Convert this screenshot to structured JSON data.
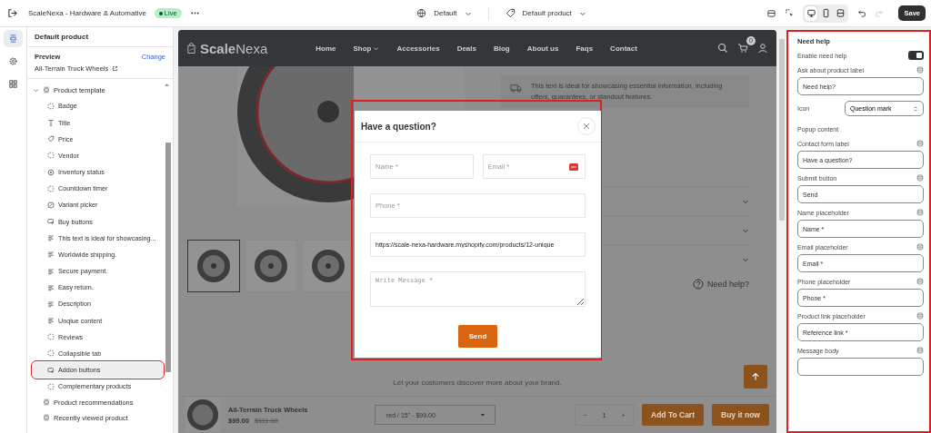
{
  "topbar": {
    "store_name": "ScaleNexa - Hardware & Automative",
    "status_badge": "Live",
    "theme_select": "Default",
    "template_select": "Default product",
    "devices": [
      {
        "kind": "desktop",
        "selected": true
      },
      {
        "kind": "mobile",
        "selected": false
      },
      {
        "kind": "split",
        "selected": false
      }
    ],
    "redo": {
      "disabled": true
    },
    "save_button": "Save"
  },
  "rail": [
    {
      "kind": "sections",
      "selected": true
    },
    {
      "kind": "settings",
      "selected": false
    },
    {
      "kind": "apps",
      "selected": false
    }
  ],
  "sidebar": {
    "title": "Default product",
    "preview_label": "Preview",
    "change_link": "Change",
    "preview_product": "All-Terrain Truck Wheels",
    "tree": [
      {
        "label": "Product template",
        "expanded": true,
        "children": [
          {
            "label": "Badge",
            "kind": "block",
            "selected": false,
            "highlighted": false
          },
          {
            "label": "Title",
            "kind": "title",
            "selected": false,
            "highlighted": false
          },
          {
            "label": "Price",
            "kind": "price",
            "selected": false,
            "highlighted": false
          },
          {
            "label": "Vendor",
            "kind": "block",
            "selected": false,
            "highlighted": false
          },
          {
            "label": "Inventory status",
            "kind": "inventory",
            "selected": false,
            "highlighted": false
          },
          {
            "label": "Countdown timer",
            "kind": "block",
            "selected": false,
            "highlighted": false
          },
          {
            "label": "Variant picker",
            "kind": "variant",
            "selected": false,
            "highlighted": false
          },
          {
            "label": "Buy buttons",
            "kind": "buttons",
            "selected": false,
            "highlighted": false
          },
          {
            "label": "This text is ideal for showcasing...",
            "kind": "text",
            "selected": false,
            "highlighted": false
          },
          {
            "label": "Worldwide shipping.",
            "kind": "text",
            "selected": false,
            "highlighted": false
          },
          {
            "label": "Secure payment.",
            "kind": "text",
            "selected": false,
            "highlighted": false
          },
          {
            "label": "Easy return.",
            "kind": "text",
            "selected": false,
            "highlighted": false
          },
          {
            "label": "Description",
            "kind": "text",
            "selected": false,
            "highlighted": false
          },
          {
            "label": "Unqiue content",
            "kind": "text",
            "selected": false,
            "highlighted": false
          },
          {
            "label": "Reviews",
            "kind": "block",
            "selected": false,
            "highlighted": false
          },
          {
            "label": "Collapsible tab",
            "kind": "block",
            "selected": false,
            "highlighted": false
          },
          {
            "label": "Addon buttons",
            "kind": "buttons",
            "selected": true,
            "highlighted": true
          },
          {
            "label": "Complementary products",
            "kind": "block",
            "selected": false,
            "highlighted": false
          }
        ]
      },
      {
        "label": "Product recommendations"
      },
      {
        "label": "Recently viewed product"
      }
    ]
  },
  "preview": {
    "logo": "**Scale**Nexa",
    "nav": [
      {
        "label": "Home",
        "has_menu": false
      },
      {
        "label": "Shop",
        "has_menu": true
      },
      {
        "label": "Accessories",
        "has_menu": false
      },
      {
        "label": "Deals",
        "has_menu": false
      },
      {
        "label": "Blog",
        "has_menu": false
      },
      {
        "label": "About us",
        "has_menu": false
      },
      {
        "label": "Faqs",
        "has_menu": false
      },
      {
        "label": "Contact",
        "has_menu": false
      }
    ],
    "cart_count": "0",
    "info_text": "This text is ideal for showcasing essential information, including offers, guarantees, or standout features.",
    "thumbnails": [
      {
        "selected": true
      },
      {
        "selected": false
      },
      {
        "selected": false
      }
    ],
    "help_link": "Need help?",
    "brand_text": "Let your customers discover more about your brand.",
    "sticky_bar": {
      "product": "All-Terrain Truck Wheels",
      "price": "$99.00",
      "compare_price": "$111.00",
      "variant": "red / 15\" - $99.00",
      "minus": "−",
      "quantity": "1",
      "plus": "+",
      "add_to_cart": "Add To Cart",
      "buy_now": "Buy it now"
    },
    "modal": {
      "title": "Have a question?",
      "highlighted": true,
      "fields": [
        {
          "kind": "half",
          "placeholder": "Name *",
          "autofill": false
        },
        {
          "kind": "half",
          "placeholder": "Email *",
          "autofill": true
        },
        {
          "kind": "full",
          "placeholder": "Phone *",
          "autofill": false
        },
        {
          "kind": "full",
          "value": "https://scale-nexa-hardware.myshopify.com/products/12-unique",
          "autofill": false
        },
        {
          "kind": "textarea",
          "placeholder": "Write Message *"
        }
      ],
      "send_button": "Send"
    }
  },
  "panel": {
    "title": "Need help",
    "highlighted": true,
    "settings": [
      {
        "kind": "toggle",
        "label": "Enable need help",
        "on": true
      },
      {
        "kind": "text",
        "label": "Ask about product label",
        "value": "Need help?"
      },
      {
        "kind": "select",
        "label": "Icon",
        "value": "Question mark"
      },
      {
        "kind": "heading",
        "label": "Popup content"
      },
      {
        "kind": "text",
        "label": "Contact form label",
        "value": "Have a question?"
      },
      {
        "kind": "text",
        "label": "Submit button",
        "value": "Send"
      },
      {
        "kind": "text",
        "label": "Name placeholder",
        "value": "Name *"
      },
      {
        "kind": "text",
        "label": "Email placeholder",
        "value": "Email *"
      },
      {
        "kind": "text",
        "label": "Phone placeholder",
        "value": "Phone *"
      },
      {
        "kind": "text",
        "label": "Product link placeholder",
        "value": "Reference link *"
      },
      {
        "kind": "text",
        "label": "Message body"
      }
    ]
  }
}
